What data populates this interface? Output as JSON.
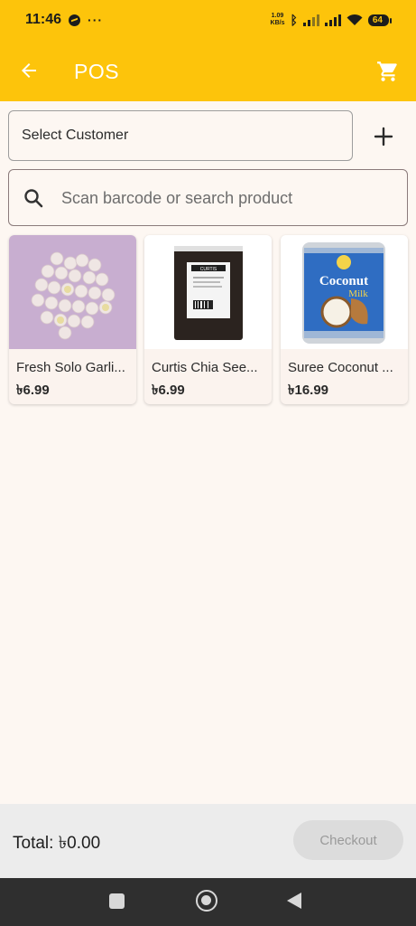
{
  "status_bar": {
    "time": "11:46",
    "dots": "···",
    "net_speed_value": "1.09",
    "net_speed_unit": "KB/s",
    "battery": "64"
  },
  "app_bar": {
    "title": "POS",
    "back_icon": "arrow-left-icon",
    "cart_icon": "cart-icon"
  },
  "customer": {
    "select_label": "Select Customer",
    "add_icon": "plus-icon"
  },
  "search": {
    "placeholder": "Scan barcode or search product",
    "icon": "search-icon"
  },
  "products": [
    {
      "name": "Fresh Solo Garli...",
      "price": "৳6.99"
    },
    {
      "name": "Curtis Chia See...",
      "price": "৳6.99"
    },
    {
      "name": "Suree Coconut ...",
      "price": "৳16.99"
    }
  ],
  "product_image_labels": {
    "curtis_brand": "CURTIS",
    "suree_brand": "Coconut",
    "suree_sub": "Milk"
  },
  "footer": {
    "total_label": "Total: ৳0.00",
    "checkout_label": "Checkout"
  },
  "colors": {
    "accent": "#fdc40b",
    "background": "#fdf7f2",
    "footer": "#ececec",
    "nav_bar": "#2f2f2f"
  }
}
